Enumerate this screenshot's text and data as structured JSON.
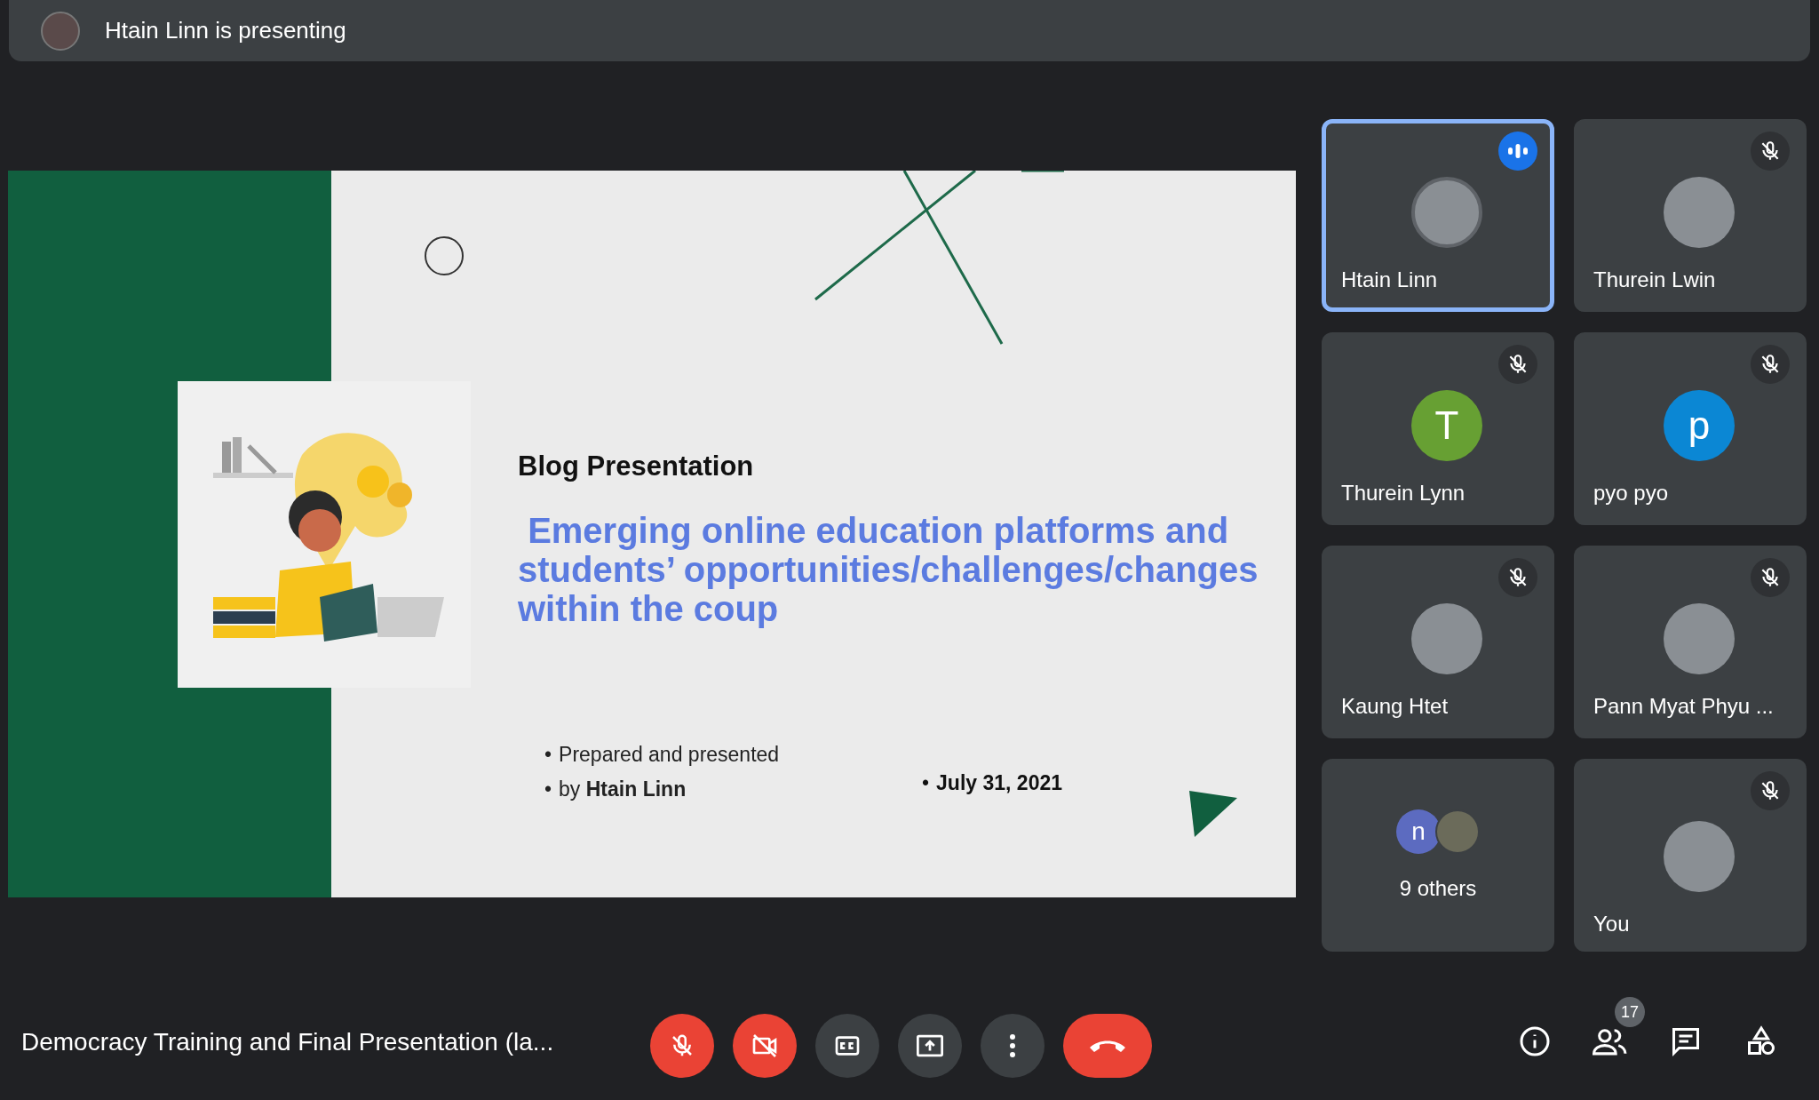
{
  "presenter_banner": {
    "text": "Htain Linn is presenting"
  },
  "slide": {
    "subtitle": "Blog Presentation",
    "title": " Emerging online education platforms and students’ opportunities/challenges/changes within the coup",
    "bullets": [
      {
        "marker": "•",
        "text": "Prepared and presented"
      },
      {
        "marker": "•",
        "text": "by **Htain Linn**"
      }
    ],
    "date": {
      "marker": "•",
      "text": "July 31, 2021"
    }
  },
  "participants": [
    {
      "kind": "person",
      "name": "Htain Linn",
      "avatar": {
        "kind": "photo"
      },
      "muted": false,
      "speaking": true,
      "selected": true
    },
    {
      "kind": "person",
      "name": "Thurein Lwin",
      "avatar": {
        "kind": "photo"
      },
      "muted": true,
      "speaking": false,
      "selected": false
    },
    {
      "kind": "person",
      "name": "Thurein Lynn",
      "avatar": {
        "kind": "letter",
        "letter": "T",
        "color": "#67a033"
      },
      "muted": true,
      "speaking": false,
      "selected": false
    },
    {
      "kind": "person",
      "name": "pyo pyo",
      "avatar": {
        "kind": "letter",
        "letter": "p",
        "color": "#0b87d4"
      },
      "muted": true,
      "speaking": false,
      "selected": false
    },
    {
      "kind": "person",
      "name": "Kaung Htet",
      "avatar": {
        "kind": "photo"
      },
      "muted": true,
      "speaking": false,
      "selected": false
    },
    {
      "kind": "person",
      "name": "Pann Myat Phyu ...",
      "avatar": {
        "kind": "photo"
      },
      "muted": true,
      "speaking": false,
      "selected": false
    },
    {
      "kind": "others",
      "name": "9 others",
      "letter": "n",
      "color": "#5c6bc0",
      "selected": false
    },
    {
      "kind": "self",
      "name": "You",
      "avatar": {
        "kind": "photo"
      },
      "muted": true,
      "speaking": false,
      "selected": false
    }
  ],
  "meeting_title": "Democracy Training and Final Presentation (la...",
  "controls": {
    "mic_on": false,
    "camera_on": false,
    "captions_on": false
  },
  "people_count": "17"
}
